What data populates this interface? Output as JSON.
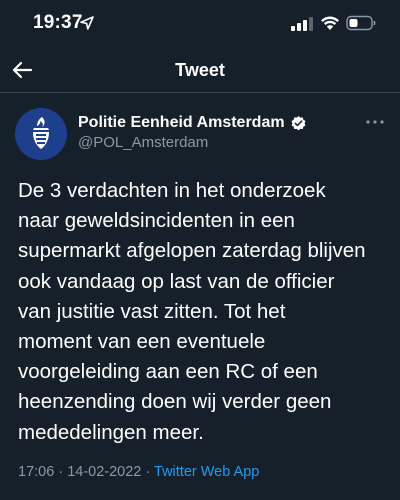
{
  "status_bar": {
    "time": "19:37"
  },
  "nav": {
    "title": "Tweet"
  },
  "tweet": {
    "author": {
      "display_name": "Politie Eenheid Amsterdam",
      "handle": "@POL_Amsterdam",
      "verified": true
    },
    "text_lines": [
      "De 3 verdachten in het onderzoek",
      "naar geweldsincidenten in een",
      "supermarkt afgelopen zaterdag blijven",
      "ook vandaag op last van de officier",
      "van justitie vast zitten. Tot het",
      "moment van een eventuele",
      "voorgeleiding aan een RC of een",
      "heenzending doen wij verder geen",
      "mededelingen meer."
    ],
    "time": "17:06",
    "separator": "·",
    "date": "14-02-2022",
    "source": "Twitter Web App"
  },
  "icons": {
    "back": "arrow-left-icon",
    "more": "ellipsis-icon",
    "verified": "verified-badge-icon",
    "location": "location-arrow-icon",
    "signal": "cellular-signal-icon",
    "wifi": "wifi-icon",
    "battery": "battery-icon"
  },
  "colors": {
    "background": "#15202b",
    "text_secondary": "#8b98a5",
    "link": "#1d9bf0",
    "divider": "#38444d",
    "avatar_bg": "#1d3f8c"
  }
}
